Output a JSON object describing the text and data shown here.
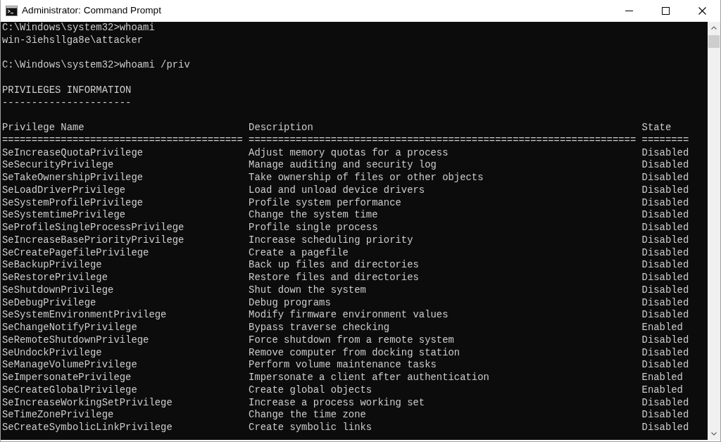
{
  "window": {
    "title": "Administrator: Command Prompt"
  },
  "console": {
    "commands": [
      {
        "line": "C:\\Windows\\system32>whoami",
        "output": [
          "win-3iehsllga8e\\attacker"
        ]
      },
      {
        "line": "C:\\Windows\\system32>whoami /priv"
      }
    ],
    "section": {
      "heading": "PRIVILEGES INFORMATION",
      "underline": "----------------------"
    },
    "table": {
      "columns": [
        {
          "label": "Privilege Name",
          "underline": "========================================="
        },
        {
          "label": "Description",
          "underline": "=================================================================="
        },
        {
          "label": "State",
          "underline": "========"
        }
      ],
      "rows": [
        {
          "name": "SeIncreaseQuotaPrivilege",
          "description": "Adjust memory quotas for a process",
          "state": "Disabled"
        },
        {
          "name": "SeSecurityPrivilege",
          "description": "Manage auditing and security log",
          "state": "Disabled"
        },
        {
          "name": "SeTakeOwnershipPrivilege",
          "description": "Take ownership of files or other objects",
          "state": "Disabled"
        },
        {
          "name": "SeLoadDriverPrivilege",
          "description": "Load and unload device drivers",
          "state": "Disabled"
        },
        {
          "name": "SeSystemProfilePrivilege",
          "description": "Profile system performance",
          "state": "Disabled"
        },
        {
          "name": "SeSystemtimePrivilege",
          "description": "Change the system time",
          "state": "Disabled"
        },
        {
          "name": "SeProfileSingleProcessPrivilege",
          "description": "Profile single process",
          "state": "Disabled"
        },
        {
          "name": "SeIncreaseBasePriorityPrivilege",
          "description": "Increase scheduling priority",
          "state": "Disabled"
        },
        {
          "name": "SeCreatePagefilePrivilege",
          "description": "Create a pagefile",
          "state": "Disabled"
        },
        {
          "name": "SeBackupPrivilege",
          "description": "Back up files and directories",
          "state": "Disabled"
        },
        {
          "name": "SeRestorePrivilege",
          "description": "Restore files and directories",
          "state": "Disabled"
        },
        {
          "name": "SeShutdownPrivilege",
          "description": "Shut down the system",
          "state": "Disabled"
        },
        {
          "name": "SeDebugPrivilege",
          "description": "Debug programs",
          "state": "Disabled"
        },
        {
          "name": "SeSystemEnvironmentPrivilege",
          "description": "Modify firmware environment values",
          "state": "Disabled"
        },
        {
          "name": "SeChangeNotifyPrivilege",
          "description": "Bypass traverse checking",
          "state": "Enabled"
        },
        {
          "name": "SeRemoteShutdownPrivilege",
          "description": "Force shutdown from a remote system",
          "state": "Disabled"
        },
        {
          "name": "SeUndockPrivilege",
          "description": "Remove computer from docking station",
          "state": "Disabled"
        },
        {
          "name": "SeManageVolumePrivilege",
          "description": "Perform volume maintenance tasks",
          "state": "Disabled"
        },
        {
          "name": "SeImpersonatePrivilege",
          "description": "Impersonate a client after authentication",
          "state": "Enabled"
        },
        {
          "name": "SeCreateGlobalPrivilege",
          "description": "Create global objects",
          "state": "Enabled"
        },
        {
          "name": "SeIncreaseWorkingSetPrivilege",
          "description": "Increase a process working set",
          "state": "Disabled"
        },
        {
          "name": "SeTimeZonePrivilege",
          "description": "Change the time zone",
          "state": "Disabled"
        },
        {
          "name": "SeCreateSymbolicLinkPrivilege",
          "description": "Create symbolic links",
          "state": "Disabled"
        }
      ]
    }
  }
}
